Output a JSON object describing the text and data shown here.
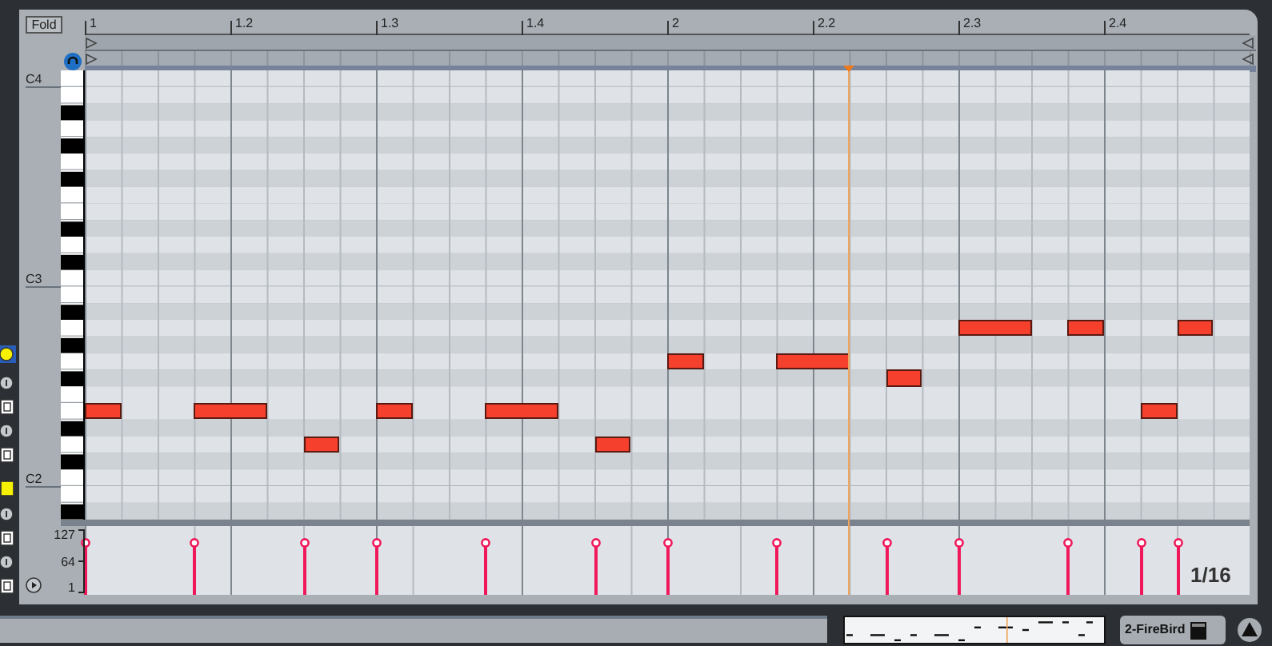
{
  "header": {
    "fold_button": "Fold"
  },
  "ruler": {
    "labels": [
      "1",
      "1.2",
      "1.3",
      "1.4",
      "2",
      "2.2",
      "2.3",
      "2.4"
    ]
  },
  "keyboard": {
    "labels": [
      "C4",
      "C3",
      "C2"
    ]
  },
  "velocity_lane": {
    "labels": [
      "127",
      "64",
      "1"
    ]
  },
  "grid_label": "1/16",
  "side_buttons": [
    {
      "kind": "circle",
      "on": true
    },
    {
      "kind": "circle",
      "on": false
    },
    {
      "kind": "square",
      "on": false
    },
    {
      "kind": "circle",
      "on": false
    },
    {
      "kind": "square",
      "on": false
    },
    {
      "kind": "square",
      "on": true
    },
    {
      "kind": "circle",
      "on": false
    },
    {
      "kind": "square",
      "on": false
    },
    {
      "kind": "circle",
      "on": false
    },
    {
      "kind": "square",
      "on": false
    }
  ],
  "status_bar": {
    "track_name": "2-FireBird"
  }
}
